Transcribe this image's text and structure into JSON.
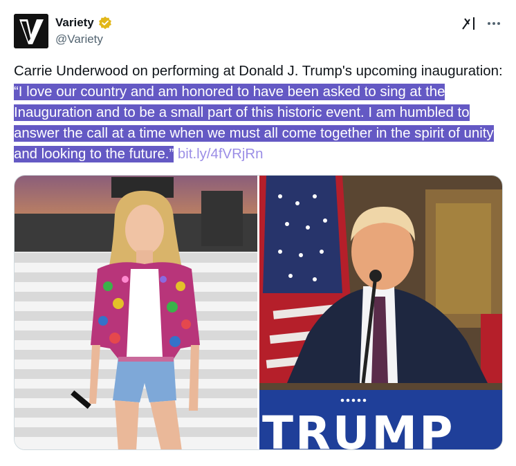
{
  "author": {
    "display_name": "Variety",
    "handle": "@Variety",
    "avatar_letter": "V",
    "verified_color": "#e2b719"
  },
  "actions": {
    "grok_icon": "grok-icon",
    "more_icon": "more-icon"
  },
  "tweet": {
    "text_intro": "Carrie Underwood on performing at Donald J. Trump's upcoming inauguration: ",
    "quote": "“I love our country and am honored to have been asked to sing at the Inauguration and to be a small part of this historic event. I am humbled to answer the call at a time when we must all come together in the spirit of unity and looking to the future.”",
    "link": "bit.ly/4fVRjRn",
    "highlight_color": "#6459c4",
    "link_color": "#9b8ee6"
  },
  "media": {
    "right_podium_text": "TRUMP"
  }
}
